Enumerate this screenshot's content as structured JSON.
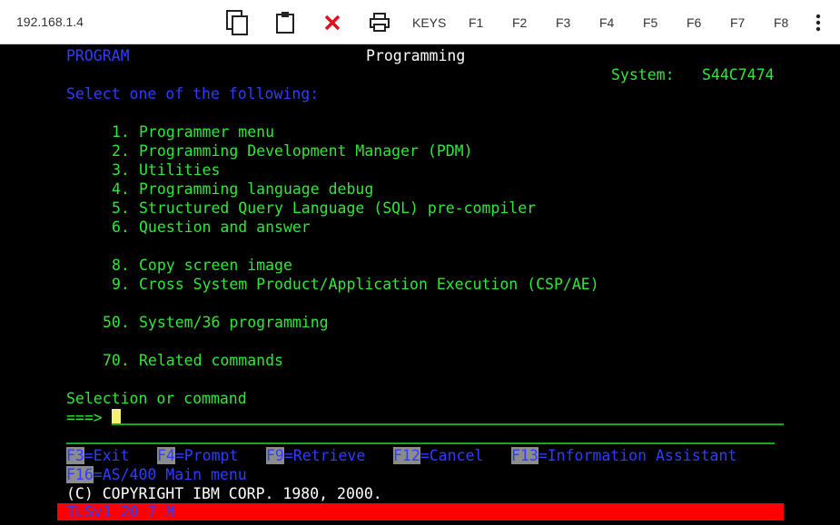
{
  "toolbar": {
    "host": "192.168.1.4",
    "icons": [
      "copy-icon",
      "paste-icon",
      "close-icon",
      "print-icon"
    ],
    "keys_label": "KEYS",
    "fkeys": [
      "F1",
      "F2",
      "F3",
      "F4",
      "F5",
      "F6",
      "F7",
      "F8"
    ]
  },
  "screen": {
    "menu_id": "PROGRAM",
    "title": "Programming",
    "system_label": "System:",
    "system_name": "S44C7474",
    "instruction": "Select one of the following:",
    "options": [
      {
        "num": "1.",
        "text": "Programmer menu"
      },
      {
        "num": "2.",
        "text": "Programming Development Manager (PDM)"
      },
      {
        "num": "3.",
        "text": "Utilities"
      },
      {
        "num": "4.",
        "text": "Programming language debug"
      },
      {
        "num": "5.",
        "text": "Structured Query Language (SQL) pre-compiler"
      },
      {
        "num": "6.",
        "text": "Question and answer"
      },
      {
        "num": "8.",
        "text": "Copy screen image"
      },
      {
        "num": "9.",
        "text": "Cross System Product/Application Execution (CSP/AE)"
      },
      {
        "num": "50.",
        "text": "System/36 programming"
      },
      {
        "num": "70.",
        "text": "Related commands"
      }
    ],
    "selection_label": "Selection or command",
    "prompt": "===>",
    "command_value": "",
    "function_keys": [
      {
        "key": "F3",
        "label": "=Exit"
      },
      {
        "key": "F4",
        "label": "=Prompt"
      },
      {
        "key": "F9",
        "label": "=Retrieve"
      },
      {
        "key": "F12",
        "label": "=Cancel"
      },
      {
        "key": "F13",
        "label": "=Information Assistant"
      },
      {
        "key": "F16",
        "label": "=AS/400 Main menu"
      }
    ],
    "copyright": "(C) COPYRIGHT IBM CORP. 1980, 2000.",
    "status": "TLSv1 20 7 M"
  },
  "colors": {
    "background": "#000000",
    "text_green": "#2ee83a",
    "text_blue": "#2f3dff",
    "text_white": "#ffffff",
    "fkey_highlight": "#8c8c8c",
    "status_bar": "#ff0000",
    "cursor": "#f4f070"
  }
}
